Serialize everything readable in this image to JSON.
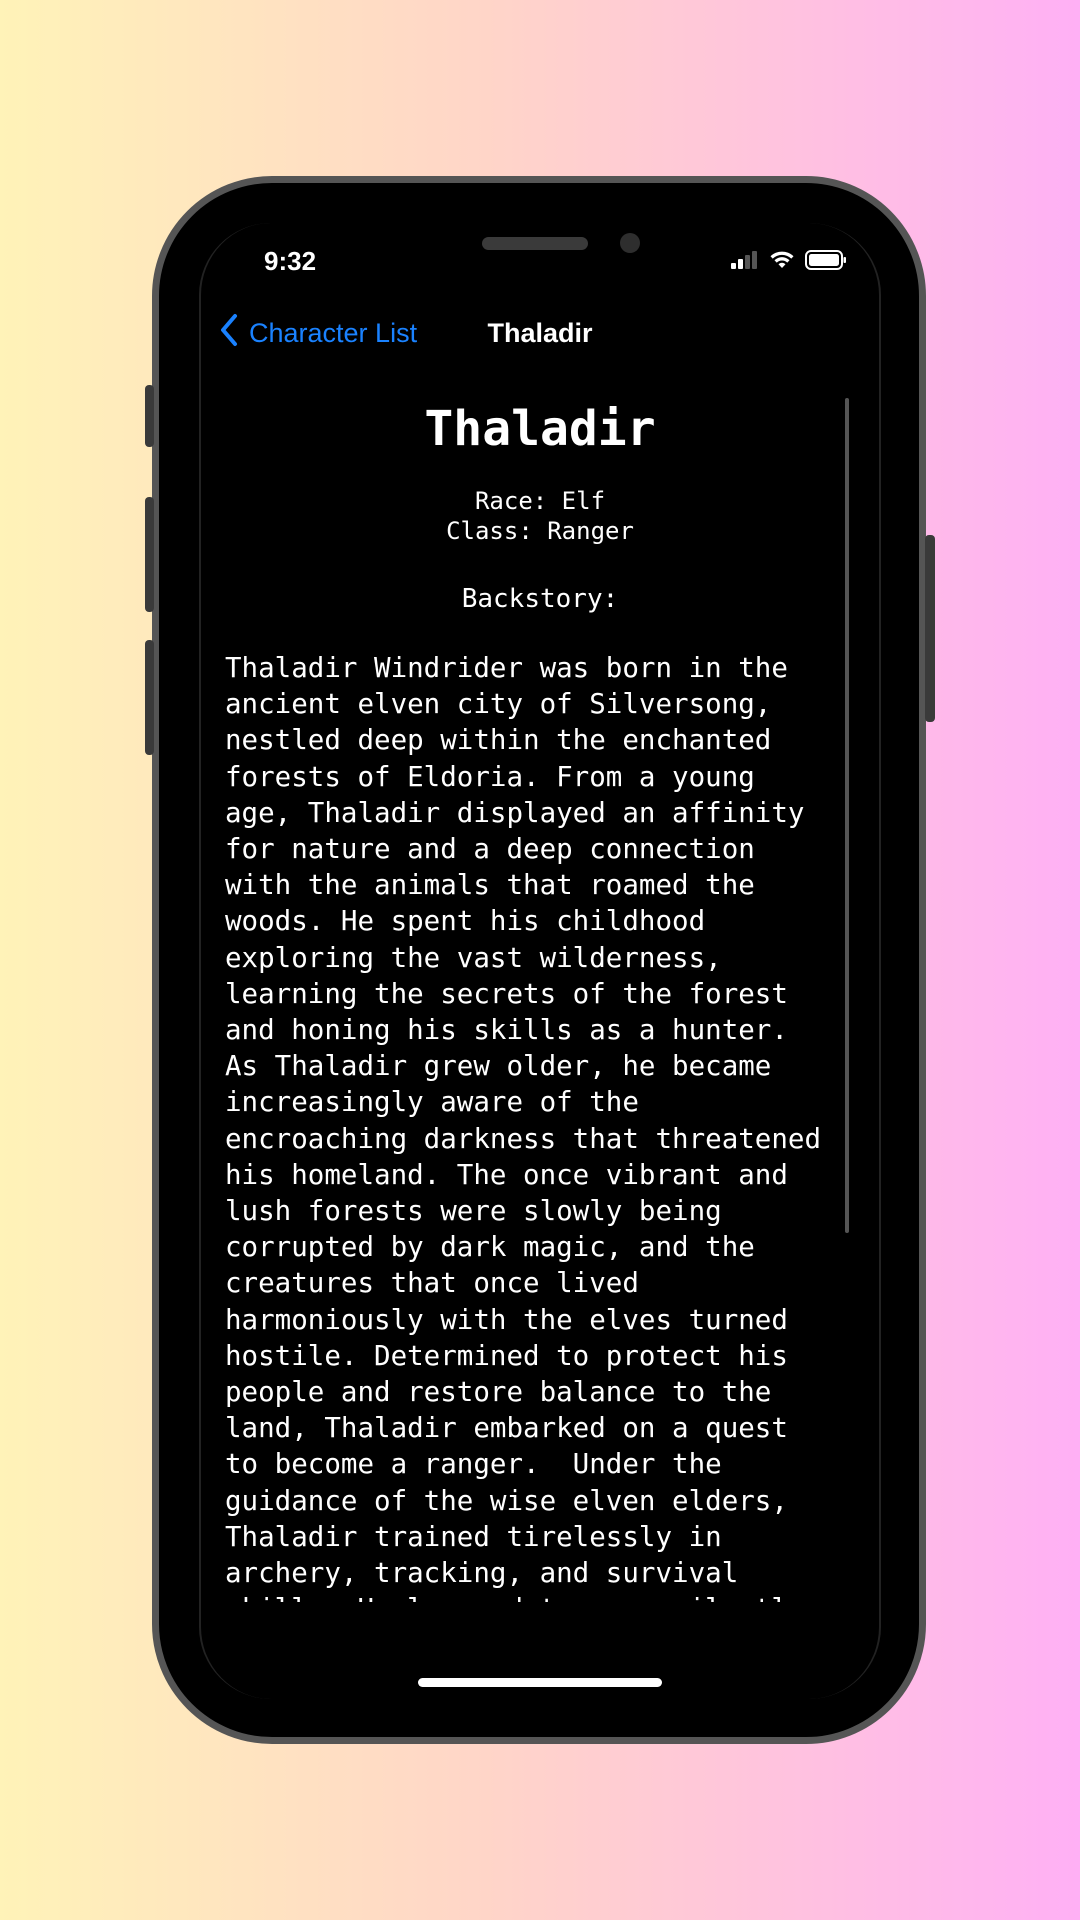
{
  "status_bar": {
    "time": "9:32"
  },
  "nav": {
    "back_label": "Character List",
    "title": "Thaladir"
  },
  "character": {
    "name": "Thaladir",
    "race_line": "Race: Elf",
    "class_line": "Class: Ranger",
    "backstory_heading": "Backstory:",
    "backstory": "Thaladir Windrider was born in the\nancient elven city of Silversong,\nnestled deep within the enchanted\nforests of Eldoria. From a young\nage, Thaladir displayed an affinity\nfor nature and a deep connection\nwith the animals that roamed the\nwoods. He spent his childhood\nexploring the vast wilderness,\nlearning the secrets of the forest\nand honing his skills as a hunter.\nAs Thaladir grew older, he became\nincreasingly aware of the\nencroaching darkness that threatened\nhis homeland. The once vibrant and\nlush forests were slowly being\ncorrupted by dark magic, and the\ncreatures that once lived\nharmoniously with the elves turned\nhostile. Determined to protect his\npeople and restore balance to the\nland, Thaladir embarked on a quest\nto become a ranger.  Under the\nguidance of the wise elven elders,\nThaladir trained tirelessly in\narchery, tracking, and survival\nskills. He learned to move silently"
  },
  "colors": {
    "accent": "#1a82ff",
    "background": "#000000",
    "text": "#ffffff"
  }
}
